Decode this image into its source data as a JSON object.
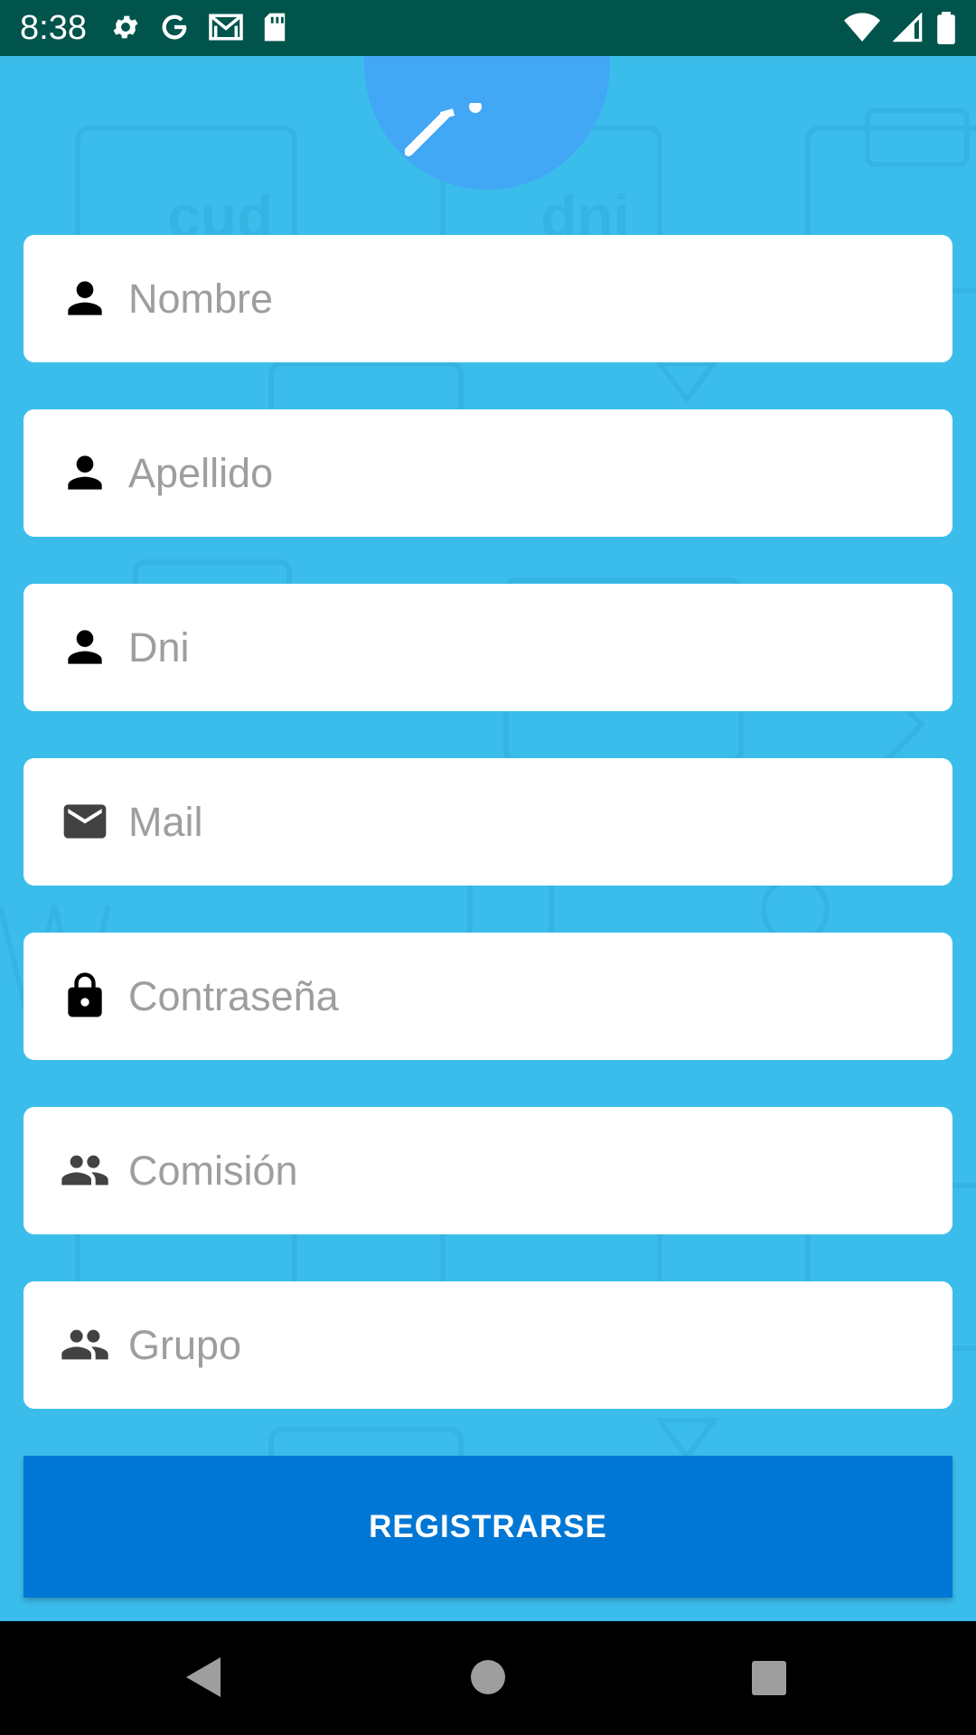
{
  "status_bar": {
    "time": "8:38",
    "icons_left": [
      "settings-icon",
      "google-icon",
      "gmail-icon",
      "sd-card-icon"
    ],
    "icons_right": [
      "wifi-icon",
      "signal-icon",
      "battery-icon"
    ]
  },
  "form": {
    "fields": [
      {
        "name": "nombre",
        "icon": "person-icon",
        "placeholder": "Nombre",
        "value": ""
      },
      {
        "name": "apellido",
        "icon": "person-icon",
        "placeholder": "Apellido",
        "value": ""
      },
      {
        "name": "dni",
        "icon": "person-icon",
        "placeholder": "Dni",
        "value": ""
      },
      {
        "name": "mail",
        "icon": "mail-icon",
        "placeholder": "Mail",
        "value": ""
      },
      {
        "name": "contrasena",
        "icon": "lock-icon",
        "placeholder": "Contraseña",
        "value": ""
      },
      {
        "name": "comision",
        "icon": "group-icon",
        "placeholder": "Comisión",
        "value": ""
      },
      {
        "name": "grupo",
        "icon": "group-icon",
        "placeholder": "Grupo",
        "value": ""
      }
    ],
    "submit_label": "REGISTRARSE"
  },
  "background": {
    "pattern_labels": [
      "cud",
      "dni"
    ]
  },
  "colors": {
    "background": "#3bbdec",
    "status_bar": "#00544b",
    "button": "#0077d4",
    "logo_circle": "#42a7f5"
  },
  "nav_bar": {
    "buttons": [
      "back-icon",
      "home-icon",
      "recents-icon"
    ]
  }
}
